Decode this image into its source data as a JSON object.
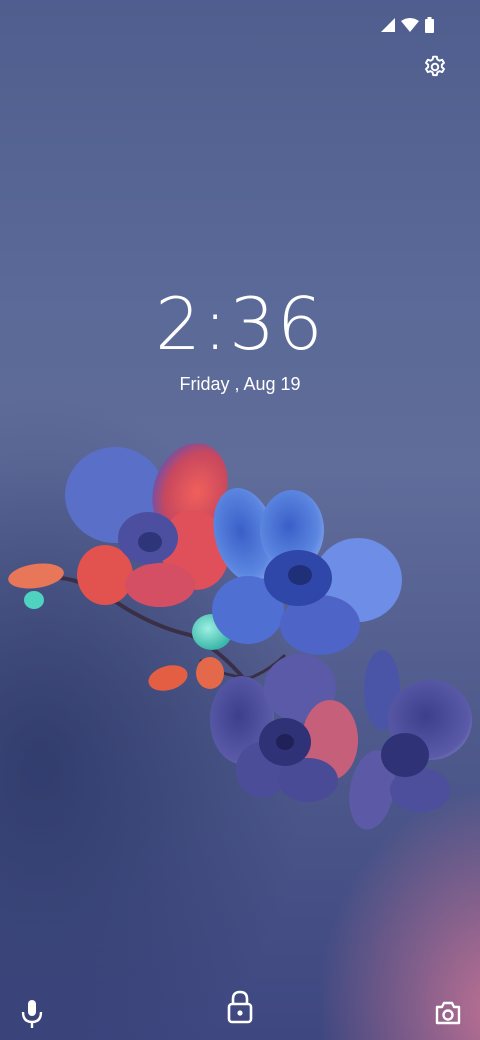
{
  "lockscreen": {
    "time": "2:36",
    "date": "Friday , Aug 19"
  },
  "status_bar": {
    "icons": [
      "cellular-signal-icon",
      "wifi-icon",
      "battery-icon"
    ]
  },
  "top_actions": {
    "icon": "gear-icon"
  },
  "bottom_actions": {
    "icons": [
      "microphone-icon",
      "lock-icon",
      "camera-icon"
    ]
  },
  "colors": {
    "text": "#ffffff",
    "wallpaper_top": "#4f5e8e",
    "wallpaper_bottom_right": "#d6789b",
    "petal_red": "#e8514d",
    "petal_blue": "#4a7bd8",
    "bud_teal": "#4fd2c0"
  }
}
